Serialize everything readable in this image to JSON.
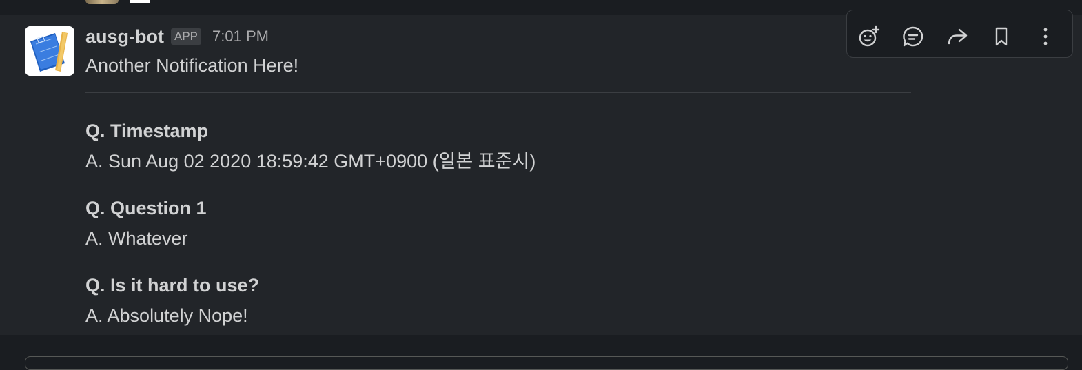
{
  "message": {
    "sender": "ausg-bot",
    "badge": "APP",
    "time": "7:01 PM",
    "text": "Another Notification Here!",
    "qa": [
      {
        "question": "Q. Timestamp",
        "answer": "A. Sun Aug 02 2020 18:59:42 GMT+0900 (일본 표준시)"
      },
      {
        "question": "Q. Question 1",
        "answer": "A. Whatever"
      },
      {
        "question": "Q. Is it hard to use?",
        "answer": "A. Absolutely Nope!"
      }
    ]
  },
  "toolbar": {
    "icons": [
      "add-reaction-icon",
      "reply-in-thread-icon",
      "share-icon",
      "bookmark-icon",
      "more-actions-icon"
    ]
  },
  "colors": {
    "background": "#1a1d21",
    "message_hover": "#222529",
    "text": "#d1d2d3",
    "muted": "#ababad"
  }
}
